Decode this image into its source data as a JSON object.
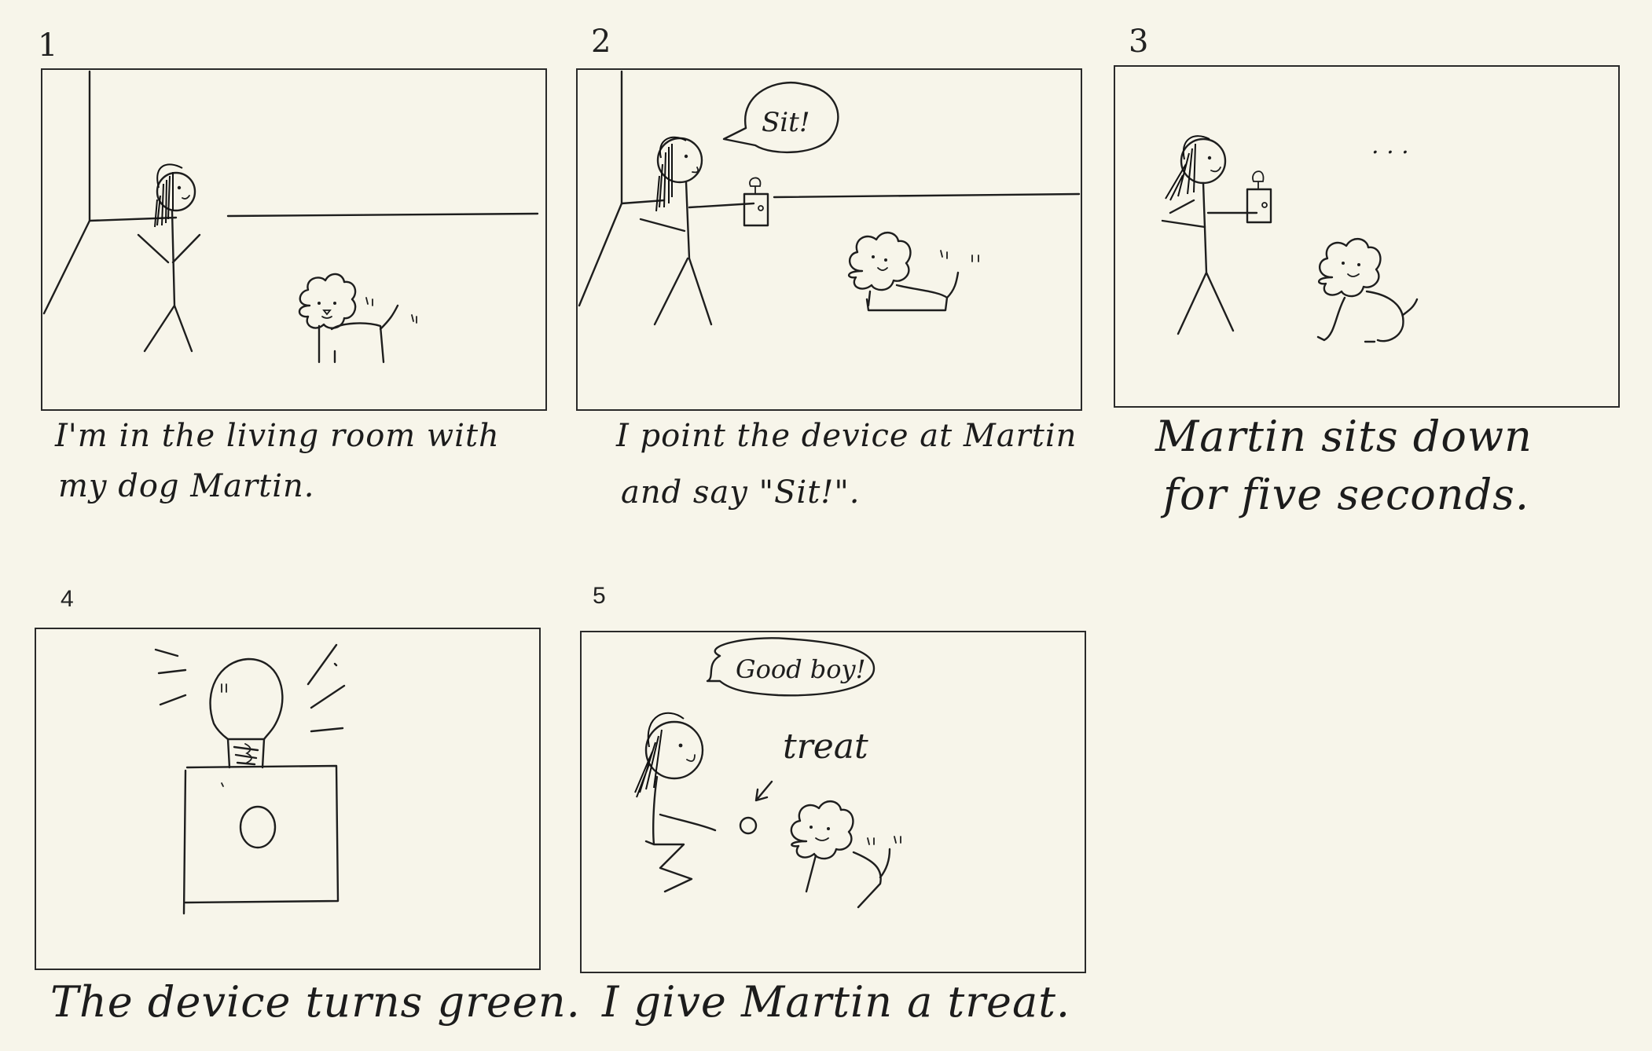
{
  "panels": [
    {
      "number": "1",
      "caption_line1": "I'm in the living room with",
      "caption_line2": "my dog Martin."
    },
    {
      "number": "2",
      "caption_line1": "I point the device at Martin",
      "caption_line2": "and say \"Sit!\".",
      "speech": "Sit!"
    },
    {
      "number": "3",
      "caption_line1": "Martin sits down",
      "caption_line2": "for five seconds.",
      "thought": ". . ."
    },
    {
      "number": "4",
      "caption_line1": "The device turns green."
    },
    {
      "number": "5",
      "caption_line1": "I give Martin a treat.",
      "speech": "Good boy!",
      "label": "treat"
    }
  ]
}
